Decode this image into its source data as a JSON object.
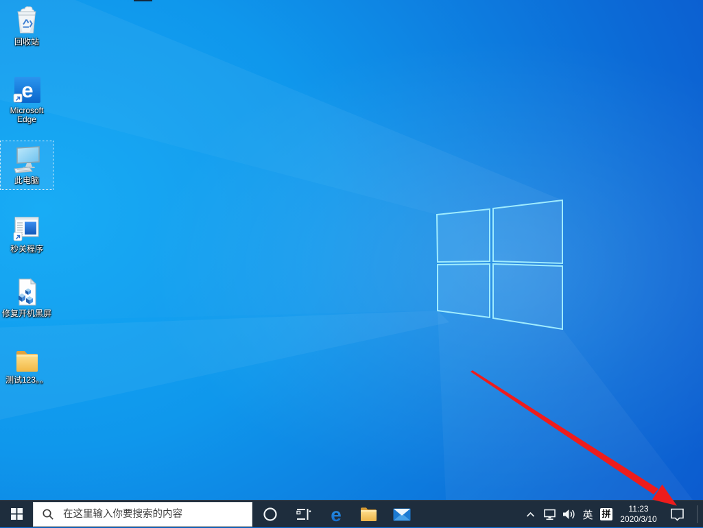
{
  "desktop": {
    "icons": [
      {
        "id": "recycle-bin",
        "label": "回收站"
      },
      {
        "id": "microsoft-edge",
        "label": "Microsoft Edge"
      },
      {
        "id": "this-pc",
        "label": "此电脑",
        "selected": true
      },
      {
        "id": "second-close-app",
        "label": "秒关程序"
      },
      {
        "id": "fix-boot-black-screen",
        "label": "修复开机黑屏"
      },
      {
        "id": "test-folder",
        "label": "测试123。。"
      }
    ]
  },
  "taskbar": {
    "search": {
      "placeholder": "在这里输入你要搜索的内容"
    },
    "buttons": [
      "cortana",
      "task-view",
      "edge",
      "file-explorer",
      "mail"
    ],
    "tray": {
      "language": "英",
      "ime": "拼",
      "time": "11:23",
      "date": "2020/3/10"
    }
  },
  "glyphs": {
    "edge_letter": "e"
  },
  "annotation": {
    "type": "arrow",
    "color": "#ee1c1c",
    "points_to": "action-center-icon"
  },
  "colors": {
    "taskbar_bg": "#1e2d3d",
    "wallpaper_left": "#14abf5",
    "wallpaper_right": "#0d48c5",
    "logo_stroke": "#a5f0ff",
    "search_bg": "#ffffff",
    "folder_yellow": "#f6bd4c",
    "edge_blue": "#1073d6"
  }
}
